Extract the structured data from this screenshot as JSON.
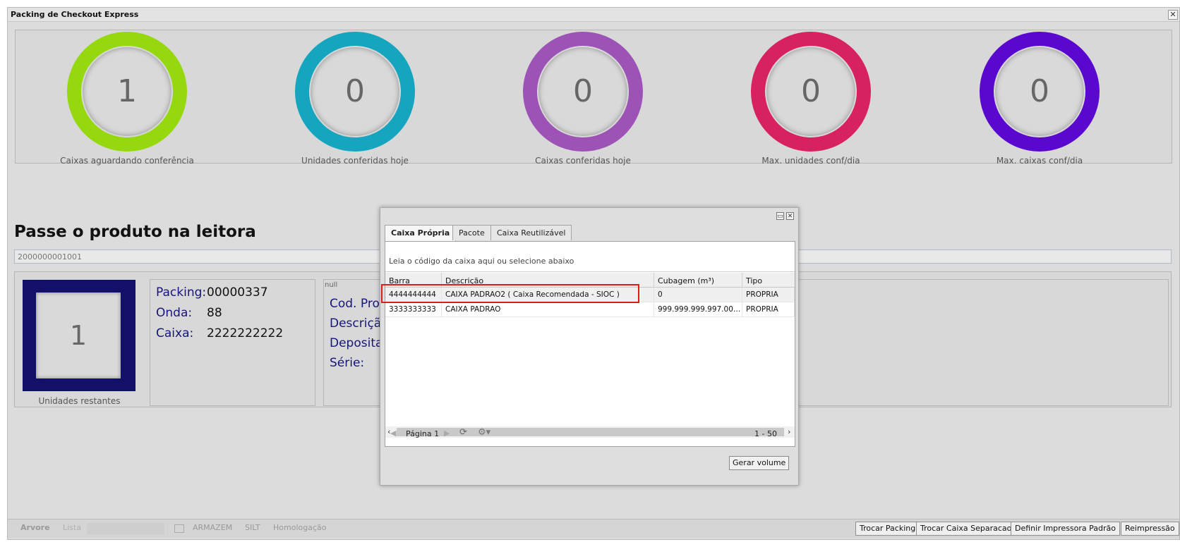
{
  "window": {
    "title": "Packing de Checkout Express",
    "close_label": "✕"
  },
  "stats": [
    {
      "value": "1",
      "label": "Caixas aguardando conferência",
      "color": "#96d80e"
    },
    {
      "value": "0",
      "label": "Unidades conferidas hoje",
      "color": "#16a5bf"
    },
    {
      "value": "0",
      "label": "Caixas conferidas hoje",
      "color": "#9d52b6"
    },
    {
      "value": "0",
      "label": "Max. unidades conf/dia",
      "color": "#d82160"
    },
    {
      "value": "0",
      "label": "Max. caixas conf/dia",
      "color": "#5a08cf"
    }
  ],
  "scan": {
    "title": "Passe o produto na leitora",
    "value": "2000000001001"
  },
  "remaining": {
    "value": "1",
    "label": "Unidades restantes"
  },
  "packing_info": {
    "packing_key": "Packing:",
    "packing_val": "00000337",
    "onda_key": "Onda:",
    "onda_val": "88",
    "caixa_key": "Caixa:",
    "caixa_val": "2222222222"
  },
  "product_info": {
    "null_label": "null",
    "cod": "Cod. Prod",
    "descricao": "Descriçã",
    "depositante": "Depositan",
    "serie": "Série:"
  },
  "dialog": {
    "tabs": [
      "Caixa Própria",
      "Pacote",
      "Caixa Reutilizável"
    ],
    "hint": "Leia o código da caixa aqui ou selecione abaixo",
    "columns": [
      "Barra",
      "Descrição",
      "Cubagem (m³)",
      "Tipo"
    ],
    "rows": [
      [
        "4444444444",
        "CAIXA PADRAO2 ( Caixa Recomendada - SIOC )",
        "0",
        "PROPRIA"
      ],
      [
        "3333333333",
        "CAIXA PADRAO",
        "999.999.999.997.000....",
        "PROPRIA"
      ]
    ],
    "paging": {
      "page_label": "Página 1",
      "range": "1 - 50"
    },
    "generate_button": "Gerar volume"
  },
  "bottombar": {
    "tab_arvore": "Arvore",
    "tab_lista": "Lista",
    "armazem": "ARMAZEM",
    "silt": "SILT",
    "homologacao": "Homologação",
    "buttons": [
      "Trocar Packing",
      "Trocar Caixa Separacao",
      "Definir Impressora Padrão",
      "Reimpressão"
    ]
  }
}
